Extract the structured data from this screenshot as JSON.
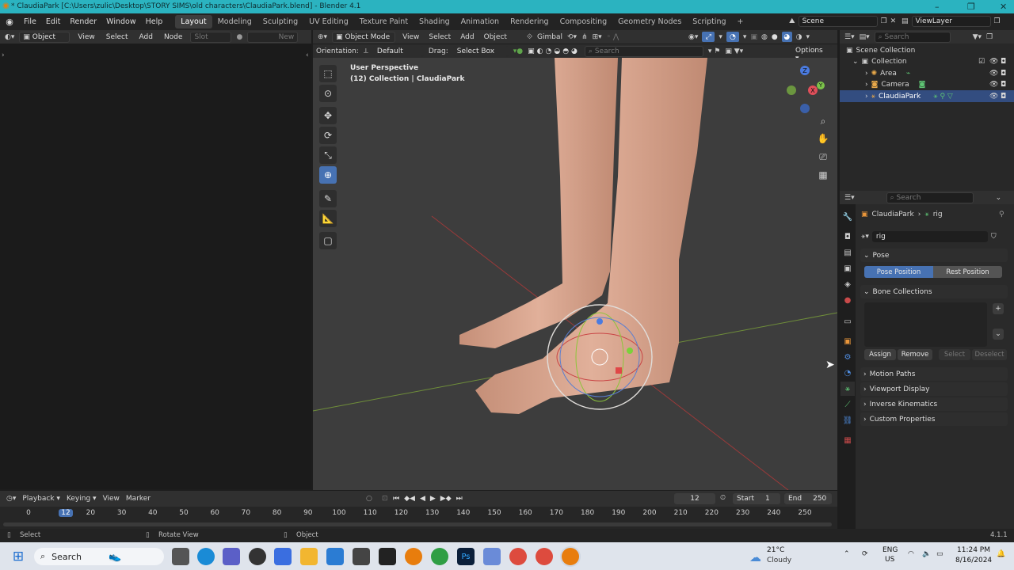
{
  "title_bar": {
    "title": "* ClaudiaPark [C:\\Users\\zulic\\Desktop\\STORY SIMS\\old characters\\ClaudiaPark.blend] - Blender 4.1"
  },
  "menu": [
    "File",
    "Edit",
    "Render",
    "Window",
    "Help"
  ],
  "workspaces": [
    "Layout",
    "Modeling",
    "Sculpting",
    "UV Editing",
    "Texture Paint",
    "Shading",
    "Animation",
    "Rendering",
    "Compositing",
    "Geometry Nodes",
    "Scripting"
  ],
  "scene": {
    "label": "Scene",
    "view_layer": "ViewLayer"
  },
  "left_editor": {
    "mode": "Object",
    "menus": [
      "View",
      "Select",
      "Add",
      "Node"
    ],
    "slot": "Slot",
    "new": "New"
  },
  "viewport": {
    "mode": "Object Mode",
    "menus": [
      "View",
      "Select",
      "Add",
      "Object"
    ],
    "transform_orientation": "Gimbal",
    "orientation_label": "Orientation:",
    "orientation_value": "Default",
    "drag_label": "Drag:",
    "drag_value": "Select Box",
    "search_placeholder": "Search",
    "options": "Options",
    "overlay_title": "User Perspective",
    "overlay_subtitle": "(12) Collection | ClaudiaPark",
    "gizmo": {
      "z": "Z",
      "y": "Y",
      "x": "X"
    }
  },
  "outliner": {
    "search_placeholder": "Search",
    "items": [
      {
        "label": "Scene Collection"
      },
      {
        "label": "Collection"
      },
      {
        "label": "Area"
      },
      {
        "label": "Camera"
      },
      {
        "label": "ClaudiaPark"
      }
    ]
  },
  "properties": {
    "search_placeholder": "Search",
    "breadcrumb_object": "ClaudiaPark",
    "breadcrumb_data": "rig",
    "data_name": "rig",
    "pose_panel": "Pose",
    "pose_position": "Pose Position",
    "rest_position": "Rest Position",
    "bone_collections": "Bone Collections",
    "assign": "Assign",
    "remove": "Remove",
    "select": "Select",
    "deselect": "Deselect",
    "motion_paths": "Motion Paths",
    "viewport_display": "Viewport Display",
    "inverse_kinematics": "Inverse Kinematics",
    "custom_properties": "Custom Properties"
  },
  "timeline": {
    "menus": [
      "Playback",
      "Keying",
      "View",
      "Marker"
    ],
    "current_frame": "12",
    "start_label": "Start",
    "start_value": "1",
    "end_label": "End",
    "end_value": "250",
    "ticks": [
      "0",
      "12",
      "20",
      "30",
      "40",
      "50",
      "60",
      "70",
      "80",
      "90",
      "100",
      "110",
      "120",
      "130",
      "140",
      "150",
      "160",
      "170",
      "180",
      "190",
      "200",
      "210",
      "220",
      "230",
      "240",
      "250"
    ]
  },
  "status_bar": {
    "select": "Select",
    "rotate_view": "Rotate View",
    "object": "Object",
    "version": "4.1.1"
  },
  "taskbar": {
    "search": "Search",
    "weather_temp": "21°C",
    "weather_desc": "Cloudy",
    "lang": "ENG",
    "region": "US",
    "time": "11:24 PM",
    "date": "8/16/2024"
  },
  "colors": {
    "accent": "#4772b3",
    "title_bar": "#2bb3c0",
    "selected_row": "#334d80",
    "skin": "#d9a88e"
  }
}
